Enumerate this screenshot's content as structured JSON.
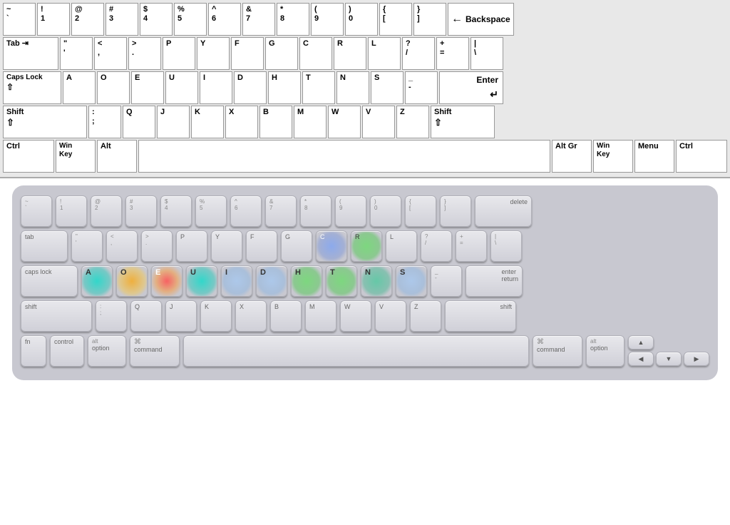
{
  "topKeyboard": {
    "rows": [
      {
        "keys": [
          {
            "top": "~",
            "bot": "`"
          },
          {
            "top": "!",
            "bot": "1"
          },
          {
            "top": "@",
            "bot": "2"
          },
          {
            "top": "#",
            "bot": "3"
          },
          {
            "top": "$",
            "bot": "4"
          },
          {
            "top": "%",
            "bot": "5"
          },
          {
            "top": "^",
            "bot": "6"
          },
          {
            "top": "&",
            "bot": "7"
          },
          {
            "top": "*",
            "bot": "8"
          },
          {
            "top": "(",
            "bot": "9"
          },
          {
            "top": ")",
            "bot": "0"
          },
          {
            "top": "{",
            "bot": "["
          },
          {
            "top": "}",
            "bot": "]"
          },
          {
            "label": "Backspace",
            "special": "backspace"
          }
        ]
      },
      {
        "keys": [
          {
            "label": "Tab",
            "special": "tab"
          },
          {
            "top": "\"",
            "bot": "'"
          },
          {
            "top": "<",
            "bot": ","
          },
          {
            "top": ">",
            "bot": "."
          },
          {
            "top": "P"
          },
          {
            "top": "Y"
          },
          {
            "top": "F"
          },
          {
            "top": "G"
          },
          {
            "top": "C"
          },
          {
            "top": "R"
          },
          {
            "top": "L"
          },
          {
            "top": "?",
            "bot": "/"
          },
          {
            "top": "+",
            "bot": "="
          },
          {
            "top": "|",
            "bot": "\\",
            "special": "enter-top"
          }
        ]
      },
      {
        "keys": [
          {
            "label": "Caps Lock",
            "special": "capslock"
          },
          {
            "top": "A"
          },
          {
            "top": "O"
          },
          {
            "top": "E"
          },
          {
            "top": "U"
          },
          {
            "top": "I"
          },
          {
            "top": "D"
          },
          {
            "top": "H"
          },
          {
            "top": "T"
          },
          {
            "top": "N"
          },
          {
            "top": "S"
          },
          {
            "top": "_",
            "bot": "-"
          },
          {
            "label": "Enter",
            "special": "enter"
          }
        ]
      },
      {
        "keys": [
          {
            "label": "Shift",
            "special": "shift-left"
          },
          {
            "top": ":",
            "bot": ";"
          },
          {
            "top": "Q"
          },
          {
            "top": "J"
          },
          {
            "top": "K"
          },
          {
            "top": "X"
          },
          {
            "top": "B"
          },
          {
            "top": "M"
          },
          {
            "top": "W"
          },
          {
            "top": "V"
          },
          {
            "top": "Z"
          },
          {
            "label": "Shift",
            "special": "shift-right"
          }
        ]
      },
      {
        "keys": [
          {
            "label": "Ctrl",
            "special": "ctrl"
          },
          {
            "label": "Win\nKey",
            "special": "win"
          },
          {
            "label": "Alt",
            "special": "alt"
          },
          {
            "label": "",
            "special": "space"
          },
          {
            "label": "Alt Gr",
            "special": "altgr"
          },
          {
            "label": "Win\nKey",
            "special": "win"
          },
          {
            "label": "Menu",
            "special": "menu"
          },
          {
            "label": "Ctrl",
            "special": "ctrl"
          }
        ]
      }
    ]
  },
  "bottomKeyboard": {
    "label": "Mac keyboard with heatmap"
  }
}
